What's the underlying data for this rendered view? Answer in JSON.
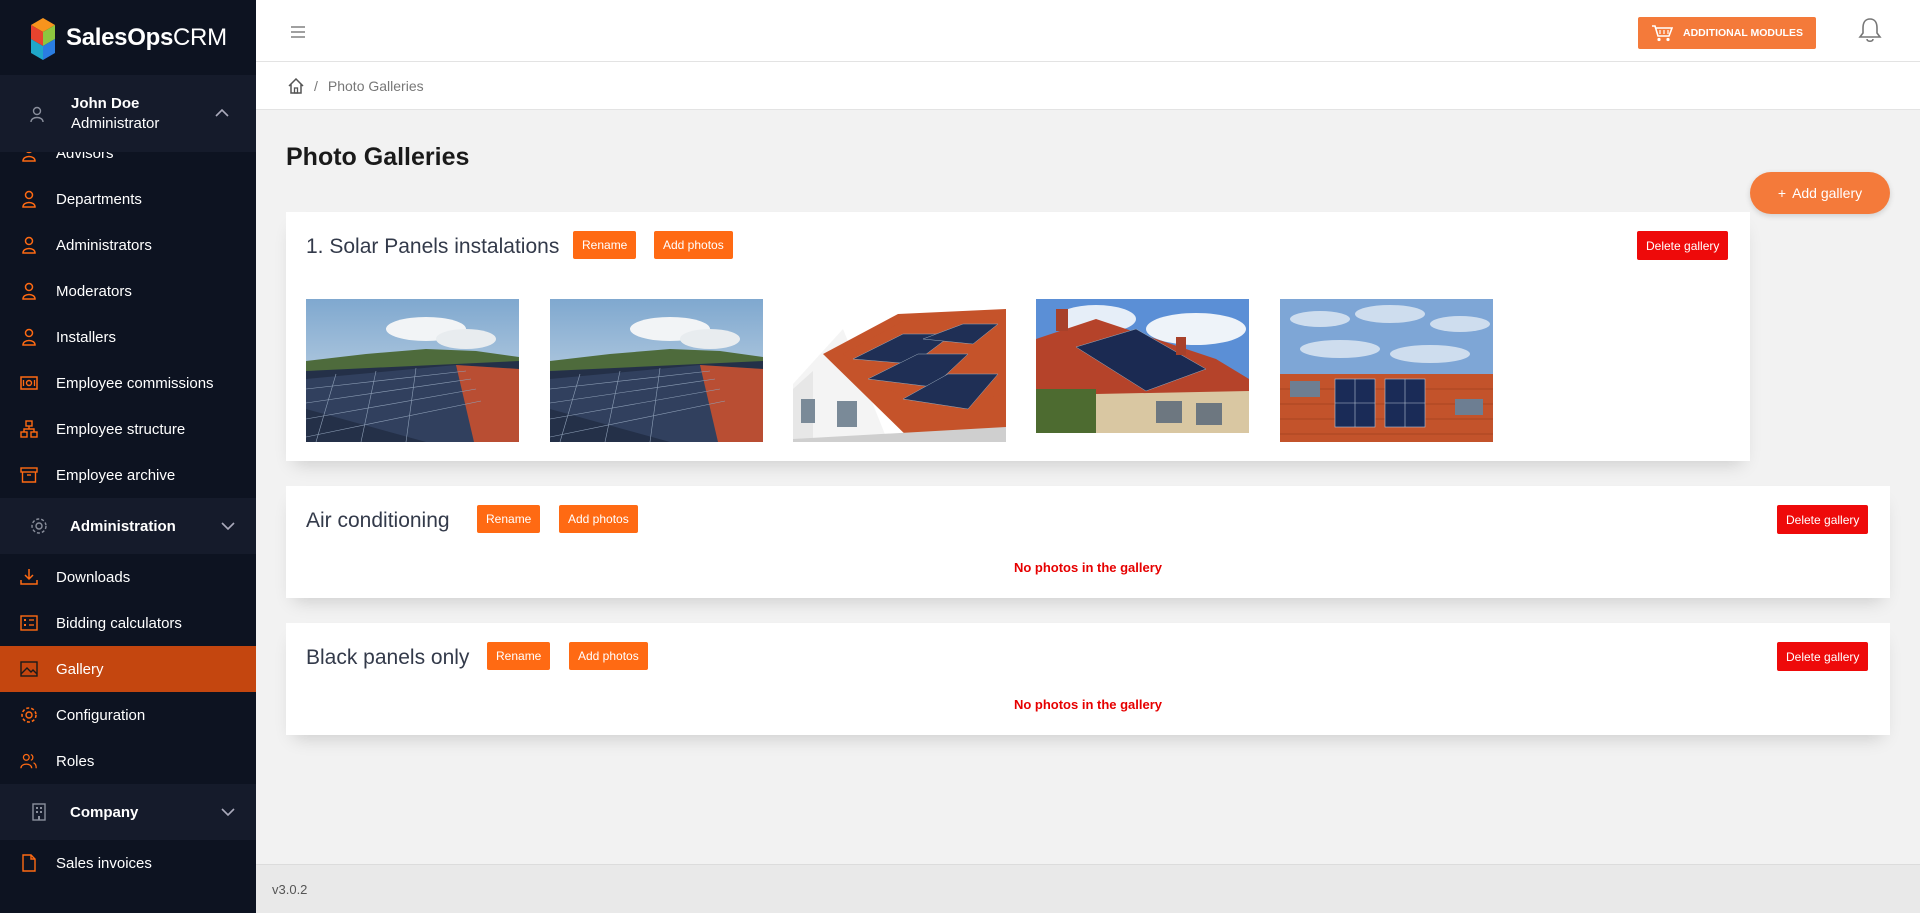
{
  "brand": {
    "name_bold": "SalesOps",
    "name_light": "CRM"
  },
  "user": {
    "name": "John Doe",
    "role": "Administrator"
  },
  "sidebar": {
    "items_top": [
      {
        "label": "Advisors",
        "icon": "user-icon"
      },
      {
        "label": "Departments",
        "icon": "user-icon"
      },
      {
        "label": "Administrators",
        "icon": "user-icon"
      },
      {
        "label": "Moderators",
        "icon": "user-icon"
      },
      {
        "label": "Installers",
        "icon": "user-icon"
      },
      {
        "label": "Employee commissions",
        "icon": "money-icon"
      },
      {
        "label": "Employee structure",
        "icon": "structure-icon"
      },
      {
        "label": "Employee archive",
        "icon": "archive-icon"
      }
    ],
    "section_admin": "Administration",
    "items_admin": [
      {
        "label": "Downloads",
        "icon": "download-icon"
      },
      {
        "label": "Bidding calculators",
        "icon": "calculator-icon"
      },
      {
        "label": "Gallery",
        "icon": "image-icon",
        "active": true
      },
      {
        "label": "Configuration",
        "icon": "gear-icon"
      },
      {
        "label": "Roles",
        "icon": "users-icon"
      }
    ],
    "section_company": "Company",
    "items_company": [
      {
        "label": "Sales invoices",
        "icon": "file-icon"
      }
    ]
  },
  "topbar": {
    "modules_label": "ADDITIONAL MODULES"
  },
  "breadcrumb": {
    "current": "Photo Galleries"
  },
  "page": {
    "title": "Photo Galleries",
    "add_gallery_label": "Add gallery"
  },
  "galleries": [
    {
      "title": "1. Solar Panels instalations",
      "rename": "Rename",
      "add_photos": "Add photos",
      "delete": "Delete gallery",
      "photos": 5
    },
    {
      "title": "Air conditioning",
      "rename": "Rename",
      "add_photos": "Add photos",
      "delete": "Delete gallery",
      "empty": "No photos in the gallery"
    },
    {
      "title": "Black panels only",
      "rename": "Rename",
      "add_photos": "Add photos",
      "delete": "Delete gallery",
      "empty": "No photos in the gallery"
    }
  ],
  "footer": {
    "version": "v3.0.2"
  },
  "colors": {
    "accent": "#f47a3a",
    "active_nav": "#c4460f",
    "danger": "#ee0a0a",
    "sidebar_bg": "#0d1321"
  }
}
